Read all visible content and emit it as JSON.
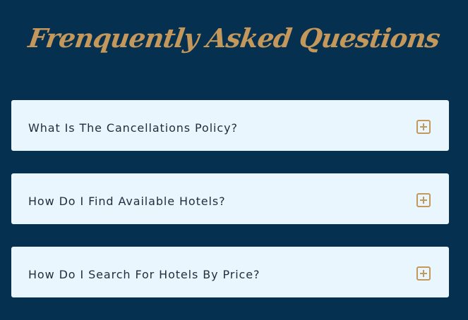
{
  "header": {
    "title": "Frenquently Asked Questions"
  },
  "faq": {
    "items": [
      {
        "question": "What Is The Cancellations Policy?",
        "icon": "plus-square-icon"
      },
      {
        "question": "How Do I Find Available Hotels?",
        "icon": "plus-square-icon"
      },
      {
        "question": "How Do I Search For Hotels By Price?",
        "icon": "plus-square-icon"
      }
    ]
  },
  "colors": {
    "background": "#05304f",
    "accent": "#c4975a",
    "card": "#e9f6fd",
    "text": "#1f2d3d"
  }
}
